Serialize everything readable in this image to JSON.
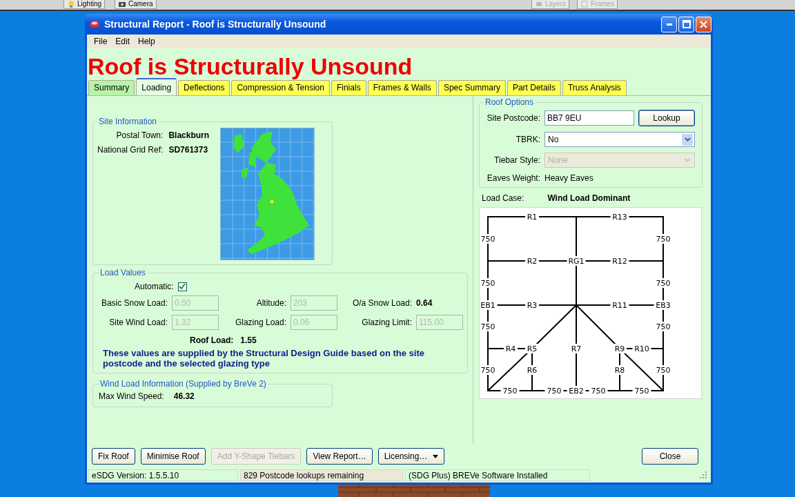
{
  "background_app": {
    "toolbar_buttons": [
      {
        "label": "Lighting",
        "disabled": false,
        "kind": "bulb"
      },
      {
        "label": "Camera",
        "disabled": false,
        "kind": "camera"
      },
      {
        "label": "Layers",
        "disabled": true,
        "kind": "layers"
      },
      {
        "label": "Frames",
        "disabled": true,
        "kind": "frames"
      }
    ]
  },
  "window": {
    "title": "Structural Report - Roof is Structurally Unsound"
  },
  "menu": [
    "File",
    "Edit",
    "Help"
  ],
  "heading": "Roof is Structurally Unsound",
  "tabs": [
    {
      "label": "Summary",
      "color": "#b8f4a8",
      "selected": false
    },
    {
      "label": "Loading",
      "color": "#e4fde2",
      "selected": true
    },
    {
      "label": "Deflections",
      "color": "#ffff55",
      "selected": false
    },
    {
      "label": "Compression & Tension",
      "color": "#ffff55",
      "selected": false
    },
    {
      "label": "Finials",
      "color": "#ffff55",
      "selected": false
    },
    {
      "label": "Frames & Walls",
      "color": "#ffff55",
      "selected": false
    },
    {
      "label": "Spec Summary",
      "color": "#ffff55",
      "selected": false
    },
    {
      "label": "Part Details",
      "color": "#ffff55",
      "selected": false
    },
    {
      "label": "Truss Analysis",
      "color": "#ffff55",
      "selected": false
    }
  ],
  "site_information": {
    "title": "Site Information",
    "fields": [
      {
        "label": "Postal Town:",
        "value": "Blackburn"
      },
      {
        "label": "National Grid Ref:",
        "value": "SD761373"
      }
    ]
  },
  "load_values": {
    "title": "Load Values",
    "automatic": {
      "label": "Automatic:",
      "checked": true
    },
    "fields": [
      {
        "label": "Basic Snow Load:",
        "value": "0.50",
        "kind": "input",
        "disabled": true
      },
      {
        "label": "Altitude:",
        "value": "203",
        "kind": "input",
        "disabled": true
      },
      {
        "label": "O/a Snow Load:",
        "value": "0.64",
        "kind": "text"
      },
      {
        "label": "Site Wind Load:",
        "value": "1.32",
        "kind": "input",
        "disabled": true
      },
      {
        "label": "Glazing Load:",
        "value": "0.06",
        "kind": "input",
        "disabled": true
      },
      {
        "label": "Glazing Limit:",
        "value": "115.00",
        "kind": "input",
        "disabled": true
      }
    ],
    "roof_load": {
      "label": "Roof Load:",
      "value": "1.55"
    },
    "note": "These values are supplied by the Structural Design Guide based on the site postcode and the selected glazing type"
  },
  "wind_load": {
    "title": "Wind Load Information (Supplied by BreVe 2)",
    "label": "Max Wind Speed:",
    "value": "46.32"
  },
  "roof_options": {
    "title": "Roof Options",
    "postcode": {
      "label": "Site Postcode:",
      "value": "BB7 9EU"
    },
    "lookup_button": "Lookup",
    "selects": [
      {
        "label": "TBRK:",
        "value": "No",
        "disabled": false
      },
      {
        "label": "Tiebar Style:",
        "value": "None",
        "disabled": true
      }
    ],
    "eaves": {
      "label": "Eaves Weight:",
      "value": "Heavy Eaves"
    }
  },
  "load_case": {
    "label": "Load Case:",
    "value": "Wind Load Dominant"
  },
  "diagram": {
    "labels": [
      "R1",
      "R13",
      "750",
      "750",
      "R2",
      "RG1",
      "R12",
      "750",
      "750",
      "EB1",
      "R3",
      "R11",
      "EB3",
      "750",
      "750",
      "R4",
      "R5",
      "R7",
      "R9",
      "R10",
      "750",
      "R6",
      "R8",
      "750",
      "750",
      "750",
      "EB2",
      "750",
      "750"
    ]
  },
  "buttons": [
    {
      "label": "Fix Roof",
      "kind": "button",
      "disabled": false
    },
    {
      "label": "Minimise Roof",
      "kind": "button",
      "disabled": false
    },
    {
      "label": "Add Y-Shape Tiebars",
      "kind": "button",
      "disabled": true
    },
    {
      "label": "View Report…",
      "kind": "button",
      "disabled": false
    },
    {
      "label": "Licensing…",
      "kind": "menu",
      "disabled": false
    }
  ],
  "close_button": "Close",
  "status_bar": [
    "eSDG Version: 1.5.5.10",
    "829 Postcode lookups remaining",
    "(SDG Plus) BREVe Software Installed"
  ]
}
